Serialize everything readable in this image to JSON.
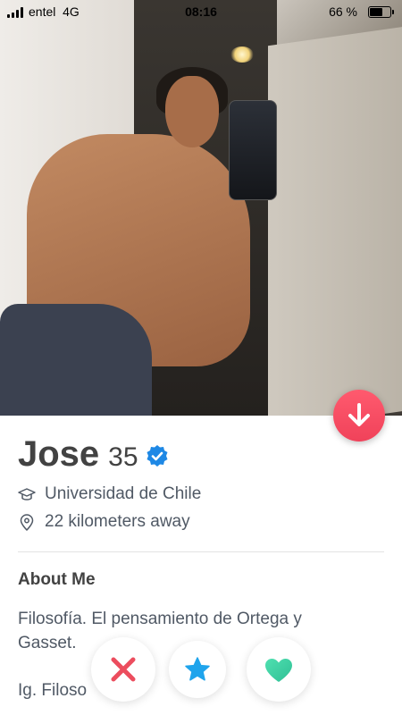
{
  "status_bar": {
    "carrier": "entel",
    "network": "4G",
    "time": "08:16",
    "battery_percent": "66 %",
    "battery_level": 0.66
  },
  "profile": {
    "name": "Jose",
    "age": "35",
    "verified": true,
    "school": "Universidad de Chile",
    "distance": "22 kilometers away",
    "about_title": "About Me",
    "about_text": "Filosofía. El pensamiento de Ortega y Gasset.",
    "ig_text": "Ig. Filoso"
  },
  "icons": {
    "down": "arrow-down-icon",
    "verified": "verified-badge-icon",
    "school": "graduation-cap-icon",
    "distance": "location-pin-icon",
    "nope": "close-icon",
    "super_like": "star-icon",
    "like": "heart-icon"
  },
  "colors": {
    "accent_red": "#f0425a",
    "nope": "#ec4d5e",
    "super_like": "#1fa4ec",
    "like": "#3ed0a3",
    "verified": "#1e88e5"
  }
}
